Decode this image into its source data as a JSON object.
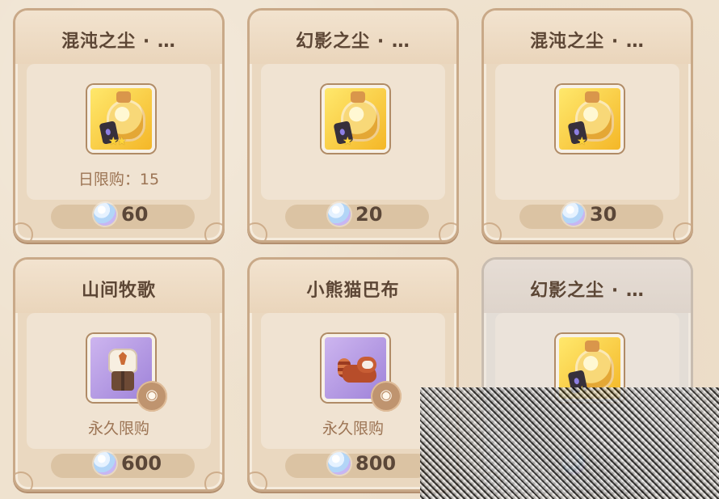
{
  "shop": {
    "cards": [
      {
        "title": "混沌之尘 · …",
        "limit": "日限购：15",
        "price": "60",
        "icon": "chaos-dust-potion-icon",
        "stars": "★★"
      },
      {
        "title": "幻影之尘 · …",
        "limit": "",
        "price": "20",
        "icon": "phantom-dust-potion-icon",
        "stars": "★"
      },
      {
        "title": "混沌之尘 · …",
        "limit": "",
        "price": "30",
        "icon": "chaos-dust-potion-icon",
        "stars": "★"
      },
      {
        "title": "山间牧歌",
        "limit": "永久限购",
        "price": "600",
        "icon": "outfit-icon"
      },
      {
        "title": "小熊猫巴布",
        "limit": "永久限购",
        "price": "800",
        "icon": "red-panda-icon"
      },
      {
        "title": "幻影之尘 · …",
        "limit": "",
        "price": "",
        "icon": "phantom-dust-potion-icon",
        "stars": "★"
      }
    ]
  },
  "colors": {
    "background": "#efe2cf",
    "card_border": "#c9a988",
    "title_text": "#5c4635",
    "limit_text": "#9c7454",
    "price_text": "#5b4738",
    "gold_item": "#f4b728",
    "purple_item": "#9f83d9"
  }
}
